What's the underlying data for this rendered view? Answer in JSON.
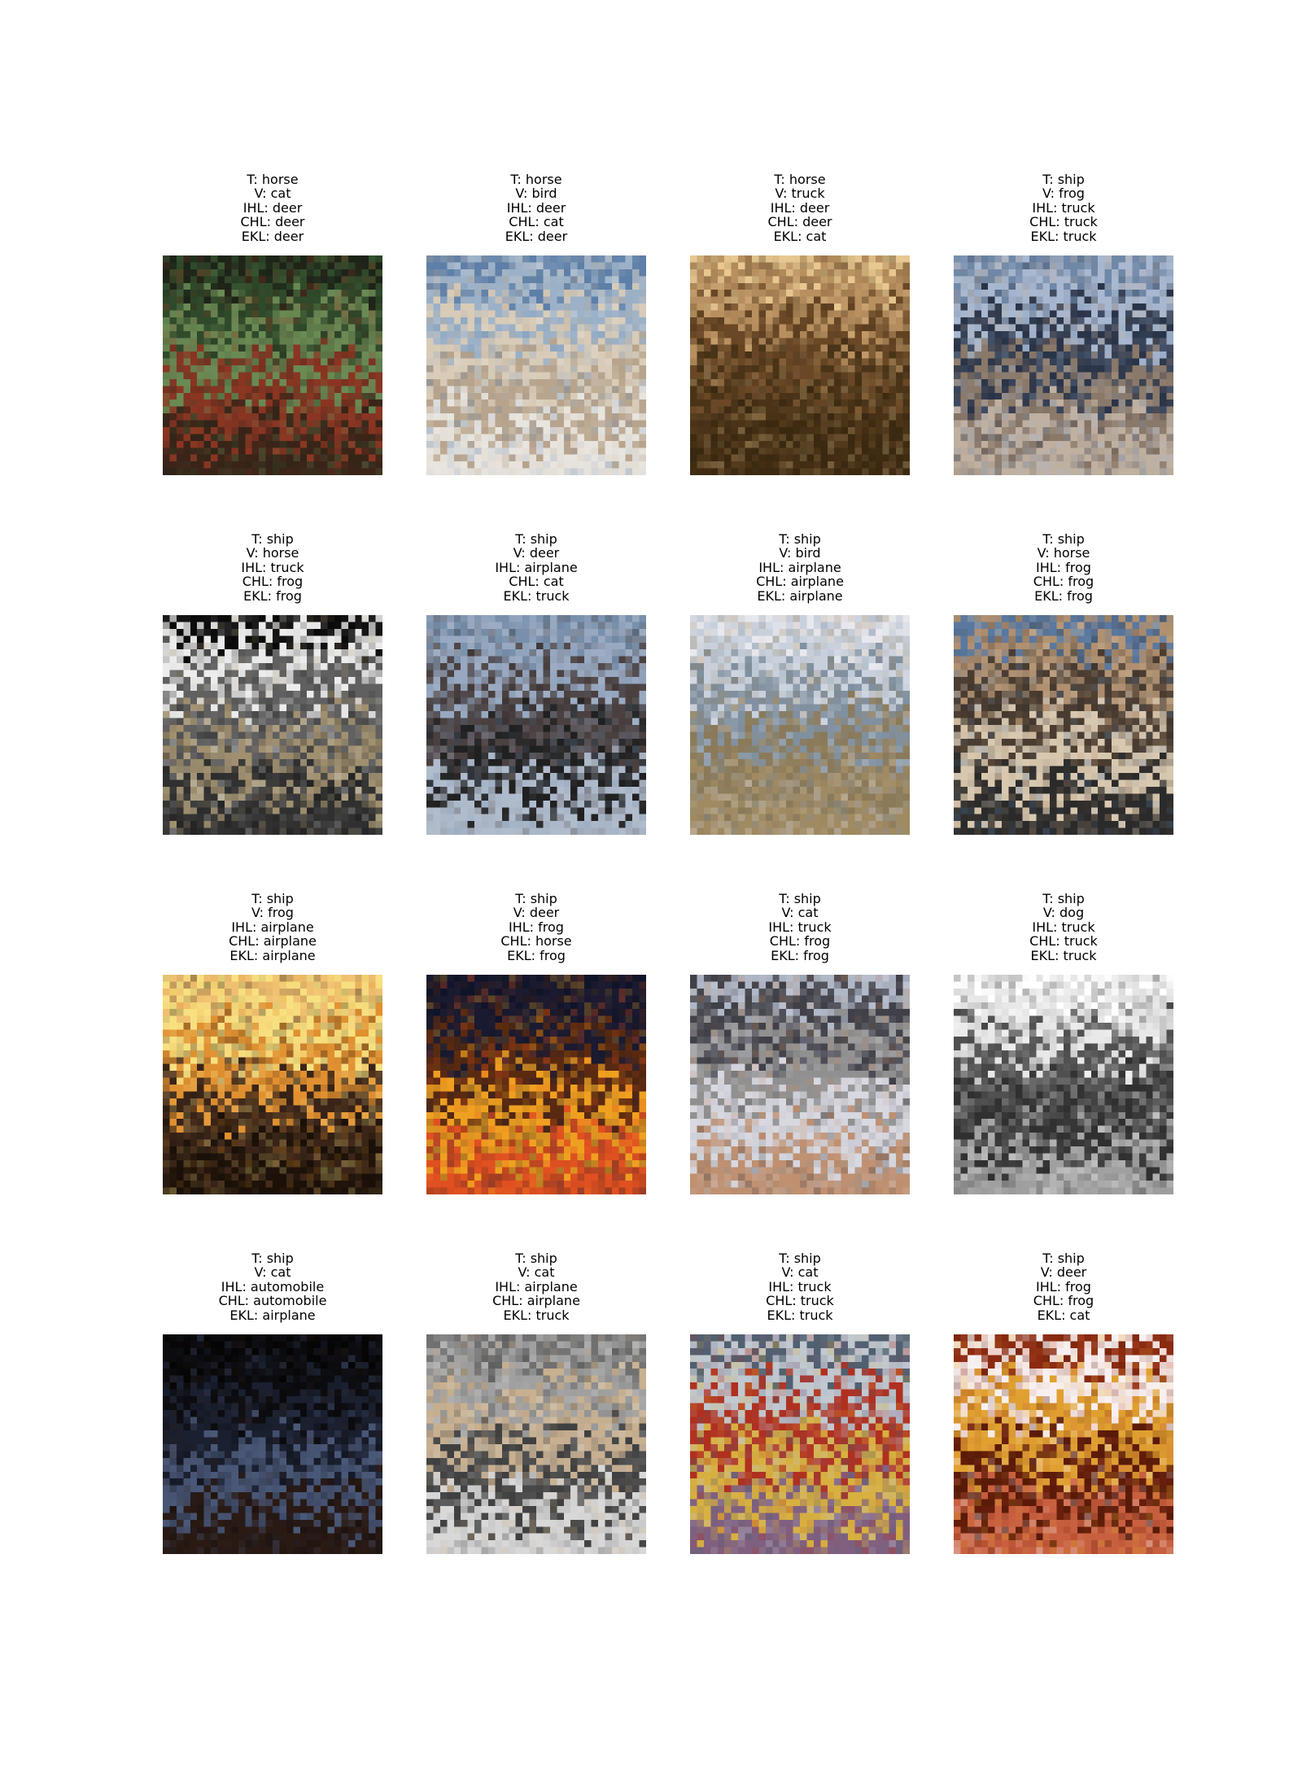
{
  "figure": {
    "panels": [
      {
        "captions": [
          "T: horse",
          "V: cat",
          "IHL: deer",
          "CHL: deer",
          "EKL: deer"
        ],
        "scene": "dark foliage with a reddish-brown figure",
        "palette": [
          "#1c2418",
          "#2f4a2a",
          "#6a8a54",
          "#8a3522",
          "#3a2418"
        ]
      },
      {
        "captions": [
          "T: horse",
          "V: bird",
          "IHL: deer",
          "CHL: cat",
          "EKL: deer"
        ],
        "scene": "pale animal head against blue sky",
        "palette": [
          "#5d7fa8",
          "#9bb1c8",
          "#d8cbb8",
          "#b8a48c",
          "#e8e4de"
        ]
      },
      {
        "captions": [
          "T: horse",
          "V: truck",
          "IHL: deer",
          "CHL: deer",
          "EKL: cat"
        ],
        "scene": "sunset silhouette over brown field",
        "palette": [
          "#e8c890",
          "#b89060",
          "#6a4826",
          "#4a3418",
          "#3a2810"
        ]
      },
      {
        "captions": [
          "T: ship",
          "V: frog",
          "IHL: truck",
          "CHL: truck",
          "EKL: truck"
        ],
        "scene": "cluttered blue and tan scene",
        "palette": [
          "#7088a8",
          "#a8b8d0",
          "#2a3448",
          "#8a7868",
          "#c0b0a0"
        ]
      },
      {
        "captions": [
          "T: ship",
          "V: horse",
          "IHL: truck",
          "CHL: frog",
          "EKL: frog"
        ],
        "scene": "white striped form on black background",
        "palette": [
          "#0a0a0a",
          "#ececec",
          "#606060",
          "#a09070",
          "#303030"
        ]
      },
      {
        "captions": [
          "T: ship",
          "V: deer",
          "IHL: airplane",
          "CHL: cat",
          "EKL: truck"
        ],
        "scene": "animals on grey-blue ground",
        "palette": [
          "#7890ac",
          "#98a8c0",
          "#4a4040",
          "#202020",
          "#b0bccc"
        ]
      },
      {
        "captions": [
          "T: ship",
          "V: bird",
          "IHL: airplane",
          "CHL: airplane",
          "EKL: airplane"
        ],
        "scene": "pale sky over flat brown ground",
        "palette": [
          "#e8e8ee",
          "#c8d0dc",
          "#8090a0",
          "#8a7a5a",
          "#a08a62"
        ]
      },
      {
        "captions": [
          "T: ship",
          "V: horse",
          "IHL: frog",
          "CHL: frog",
          "EKL: frog"
        ],
        "scene": "crowded harbour with blue sky",
        "palette": [
          "#5a78a0",
          "#b09070",
          "#4a3c30",
          "#d8c8b0",
          "#2a2a2a"
        ]
      },
      {
        "captions": [
          "T: ship",
          "V: frog",
          "IHL: airplane",
          "CHL: airplane",
          "EKL: airplane"
        ],
        "scene": "golden sunset with dark boat silhouette",
        "palette": [
          "#f0c070",
          "#f8e080",
          "#e09030",
          "#3a2418",
          "#1a1008"
        ]
      },
      {
        "captions": [
          "T: ship",
          "V: deer",
          "IHL: frog",
          "CHL: horse",
          "EKL: frog"
        ],
        "scene": "dark night scene with orange lights",
        "palette": [
          "#101428",
          "#1a1a30",
          "#5a2a10",
          "#f0a020",
          "#e05020"
        ]
      },
      {
        "captions": [
          "T: ship",
          "V: cat",
          "IHL: truck",
          "CHL: frog",
          "EKL: frog"
        ],
        "scene": "grey structure with striped pattern",
        "palette": [
          "#b0b8c8",
          "#404048",
          "#909090",
          "#d8d8e0",
          "#c09070"
        ]
      },
      {
        "captions": [
          "T: ship",
          "V: dog",
          "IHL: truck",
          "CHL: truck",
          "EKL: truck"
        ],
        "scene": "grey curved hull against white",
        "palette": [
          "#ffffff",
          "#e8e8e8",
          "#505050",
          "#303030",
          "#a0a0a0"
        ]
      },
      {
        "captions": [
          "T: ship",
          "V: cat",
          "IHL: automobile",
          "CHL: automobile",
          "EKL: airplane"
        ],
        "scene": "very dark scene with faint blue shape",
        "palette": [
          "#050505",
          "#0c0c10",
          "#1a2030",
          "#4a5878",
          "#2a1a14"
        ]
      },
      {
        "captions": [
          "T: ship",
          "V: cat",
          "IHL: airplane",
          "CHL: airplane",
          "EKL: truck"
        ],
        "scene": "grey clutter with tan objects",
        "palette": [
          "#707070",
          "#a0a0a0",
          "#c8b090",
          "#404040",
          "#d8d8d8"
        ]
      },
      {
        "captions": [
          "T: ship",
          "V: cat",
          "IHL: truck",
          "CHL: truck",
          "EKL: truck"
        ],
        "scene": "colourful storefront with red and yellow",
        "palette": [
          "#506070",
          "#c0c8d0",
          "#b03020",
          "#d8b040",
          "#806080"
        ]
      },
      {
        "captions": [
          "T: ship",
          "V: deer",
          "IHL: frog",
          "CHL: frog",
          "EKL: cat"
        ],
        "scene": "warm red and yellow scene with bright spots",
        "palette": [
          "#8a2a10",
          "#f8f0f0",
          "#e0a030",
          "#5a1a08",
          "#c86040"
        ]
      }
    ]
  }
}
